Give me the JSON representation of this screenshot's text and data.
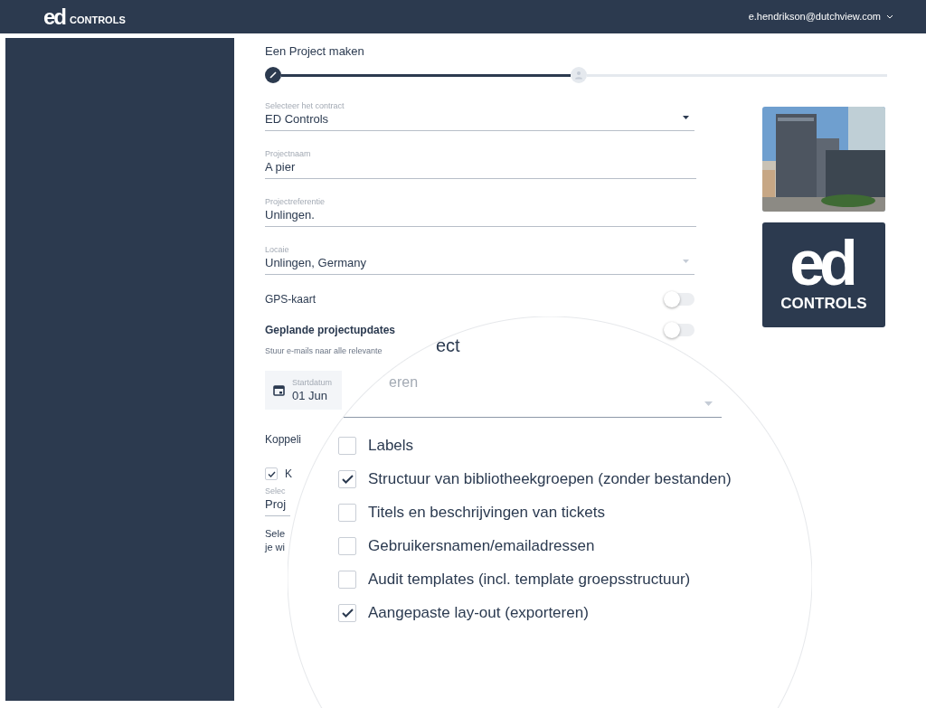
{
  "navbar": {
    "logo_mark": "ed",
    "logo_text": "CONTROLS",
    "user": "e.hendrikson@dutchview.com"
  },
  "page_title": "Een Project maken",
  "steps": [
    {
      "active": true
    },
    {
      "active": false
    }
  ],
  "fields": [
    {
      "label": "Selecteer het contract",
      "value": "ED Controls",
      "kind": "select"
    },
    {
      "label": "Projectnaam",
      "value": "A pier",
      "kind": "text"
    },
    {
      "label": "Projectreferentie",
      "value": "Unlingen.",
      "kind": "text"
    },
    {
      "label": "Locaie",
      "value": "Unlingen, Germany",
      "kind": "select-faded"
    }
  ],
  "toggles": [
    {
      "label": "GPS-kaart",
      "on": false,
      "kind": "plain"
    },
    {
      "label": "Geplande projectupdates",
      "on": false,
      "kind": "bold"
    }
  ],
  "toggle_hint": "Stuur e-mails naar alle relevante",
  "date_field": {
    "label": "Startdatum",
    "value": "01 Jun"
  },
  "section_heading": "Koppeli",
  "link_checkbox": {
    "label": "K",
    "checked": true
  },
  "link_select": {
    "label": "Selec",
    "value": "Proj"
  },
  "help_lines": [
    "Sele",
    "je wi"
  ],
  "brand_card": {
    "logo_mark": "ed",
    "logo_text": "CONTROLS"
  },
  "magnifier": {
    "heading": "ect",
    "sublabel": "eren",
    "options": [
      {
        "label": "Labels",
        "checked": false
      },
      {
        "label": "Structuur van bibliotheekgroepen (zonder bestanden)",
        "checked": true
      },
      {
        "label": "Titels en beschrijvingen van tickets",
        "checked": false
      },
      {
        "label": "Gebruikersnamen/emailadressen",
        "checked": false
      },
      {
        "label": "Audit templates (incl. template groepsstructuur)",
        "checked": false
      },
      {
        "label": "Aangepaste lay-out (exporteren)",
        "checked": true
      }
    ]
  }
}
